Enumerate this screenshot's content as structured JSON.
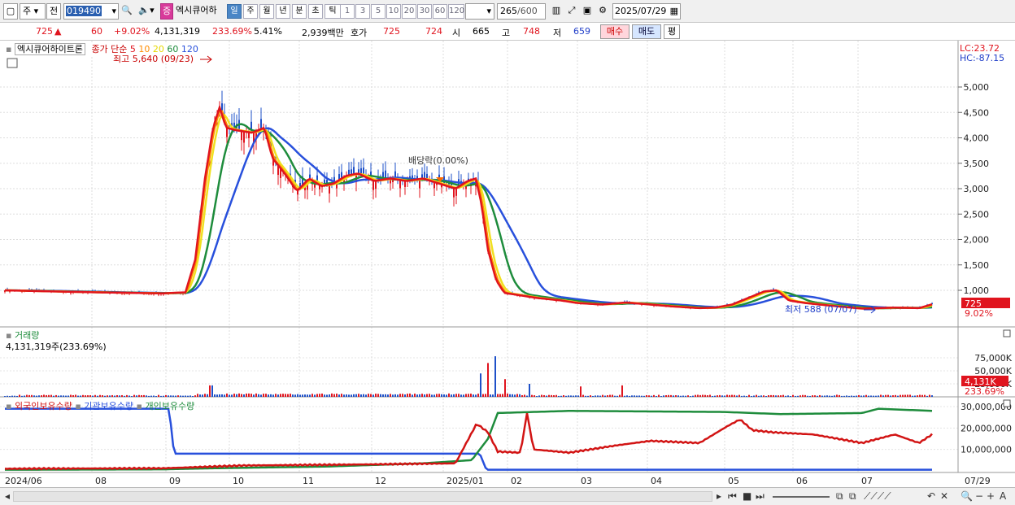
{
  "toolbar": {
    "market": "주",
    "type": "전",
    "code": "019490",
    "margin_badge": "증",
    "stock_name": "엑시큐어하",
    "periods": [
      "일",
      "주",
      "월",
      "년",
      "분",
      "초",
      "틱"
    ],
    "active_period": "일",
    "intervals": [
      "1",
      "3",
      "5",
      "10",
      "20",
      "30",
      "60",
      "120"
    ],
    "count": "265",
    "count_max": "/600",
    "date": "2025/07/29"
  },
  "quote": {
    "price": "725",
    "change_arrow": "▲",
    "change": "60",
    "change_pct": "+9.02%",
    "volume": "4,131,319",
    "vol_ratio": "233.69%",
    "turnover": "5.41%",
    "amount": "2,939백만",
    "hoga_label": "호가",
    "ask": "725",
    "bid": "724",
    "open_label": "시",
    "open": "665",
    "high_label": "고",
    "high": "748",
    "low_label": "저",
    "low": "659",
    "buy_label": "매수",
    "sell_label": "매도",
    "eval_label": "평"
  },
  "price_panel": {
    "stock_label": "엑시큐어하이트론",
    "ma_label": "종가 단순",
    "ma_periods": [
      "5",
      "10",
      "20",
      "60",
      "120"
    ],
    "ma_colors": [
      "#e0141e",
      "#ff8c00",
      "#e6d800",
      "#1e8c3c",
      "#2850dc"
    ],
    "high_note": "최고 5,640 (09/23)",
    "low_note": "최저 588 (07/07)",
    "dividend_note": "배당락(0.00%)",
    "lc": "LC:23.72",
    "hc": "HC:-87.15",
    "y_ticks": [
      "5,000",
      "4,500",
      "4,000",
      "3,500",
      "3,000",
      "2,500",
      "2,000",
      "1,500",
      "1,000"
    ],
    "price_tag": "725",
    "pct_tag": "9.02%"
  },
  "volume_panel": {
    "title": "거래량",
    "value": "4,131,319주(233.69%)",
    "y_ticks": [
      "75,000K",
      "50,000K",
      "25,000K"
    ],
    "tag": "4,131K",
    "pct": "233.69%"
  },
  "holdings_panel": {
    "legend": [
      "외국인보유수량",
      "기관보유수량",
      "개인보유수량"
    ],
    "y_ticks": [
      "30,000,000",
      "20,000,000",
      "10,000,000"
    ]
  },
  "x_axis": [
    "2024/06",
    "08",
    "09",
    "10",
    "11",
    "12",
    "2025/01",
    "02",
    "03",
    "04",
    "05",
    "06",
    "07",
    "07/29"
  ]
}
